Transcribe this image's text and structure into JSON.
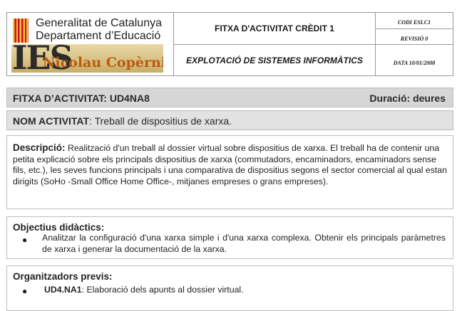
{
  "header": {
    "org_line1": "Generalitat de Catalunya",
    "org_line2": "Departament d’Educació",
    "school_logo_big": "IES",
    "school_logo_name": "Nicolau Copèrnic",
    "title": "FITXA D'ACTIVITAT CRÈDIT 1",
    "subtitle": "EXPLOTACIÓ DE SISTEMES INFORMÀTICS",
    "code": "CODI ESI.C1",
    "revision": "REVISIÓ 0",
    "date": "DATA 10/01/2008"
  },
  "activity": {
    "id_label": "FITXA D’ACTIVITAT: UD4NA8",
    "duration_label": "Duració: deures",
    "name_label": "NOM ACTIVITAT",
    "name_value": ": Treball de dispositius de xarxa."
  },
  "description": {
    "label": "Descripció:",
    "text": " Realització d'un treball al dossier virtual sobre dispositius de xarxa. El treball ha de contenir una petita explicació sobre els principals dispositius de xarxa (commutadors, encaminadors, encaminadors sense fils, etc.), les seves funcions principals i una comparativa de dispositius segons el sector comercial al qual estan dirigits (SoHo -Small Office Home Office-, mitjanes empreses o  grans empreses)."
  },
  "objectives": {
    "label": "Objectius didàctics:",
    "items": [
      "Analitzar la configuració d'una xarxa simple i d'una xarxa complexa. Obtenir els principals paràmetres de xarxa i generar la documentació de la xarxa."
    ]
  },
  "organizers": {
    "label": "Organitzadors previs:",
    "items": [
      {
        "code": "UD4.NA1",
        "text": ": Elaboració dels apunts al dossier virtual."
      }
    ]
  },
  "colors": {
    "bar_gray": "#d6d6d6",
    "logo_orange": "#b85a12",
    "flag_red": "#c8102e",
    "flag_yellow": "#f4c430"
  }
}
